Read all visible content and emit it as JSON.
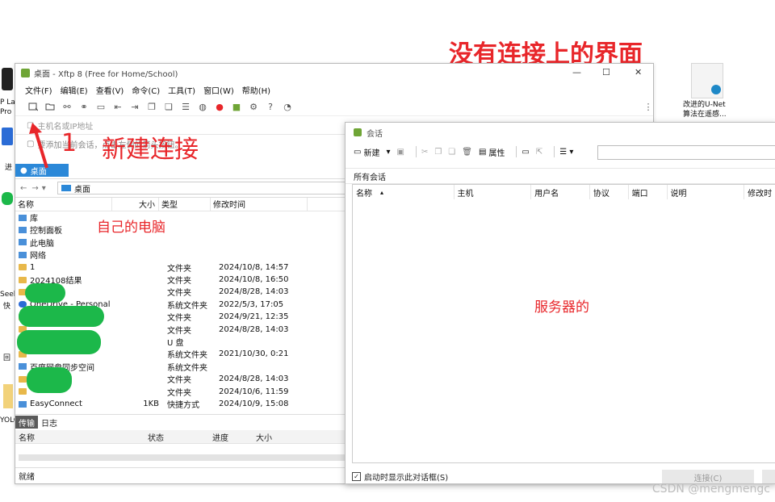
{
  "annotations": {
    "title": "没有连接上的界面",
    "step_number": "1",
    "new_connection": "新建连接",
    "my_computer": "自己的电脑",
    "server": "服务器的"
  },
  "colors": {
    "annotation_red": "#e8262a",
    "accent_blue": "#2b88d8",
    "blot_green": "#1cb84a"
  },
  "desktop": {
    "left_labels": [
      "P La",
      "Pro N",
      "进",
      "Seek",
      "快",
      "回",
      "YOLO"
    ],
    "icon_label_line1": "改进的U-Net",
    "icon_label_line2": "算法在遥感..."
  },
  "window": {
    "title": "桌面 - Xftp 8 (Free for Home/School)",
    "controls": {
      "minimize": "—",
      "maximize": "☐",
      "close": "✕"
    },
    "menu": [
      "文件(F)",
      "编辑(E)",
      "查看(V)",
      "命令(C)",
      "工具(T)",
      "窗口(W)",
      "帮助(H)"
    ],
    "host_placeholder": "主机名或IP地址",
    "tip_text": "要添加当前会话，点击左侧的箭头按钮。",
    "tab_label": "桌面",
    "path": "桌面",
    "columns": {
      "name": "名称",
      "size": "大小",
      "type": "类型",
      "modified": "修改时间"
    },
    "files": [
      {
        "name": "库",
        "size": "",
        "type": "",
        "modified": "",
        "icon": "library-icon"
      },
      {
        "name": "控制面板",
        "size": "",
        "type": "",
        "modified": "",
        "icon": "control-panel-icon"
      },
      {
        "name": "此电脑",
        "size": "",
        "type": "",
        "modified": "",
        "icon": "computer-icon"
      },
      {
        "name": "网络",
        "size": "",
        "type": "",
        "modified": "",
        "icon": "network-icon"
      },
      {
        "name": "1",
        "size": "",
        "type": "文件夹",
        "modified": "2024/10/8, 14:57",
        "icon": "folder-icon"
      },
      {
        "name": "2024108结果",
        "size": "",
        "type": "文件夹",
        "modified": "2024/10/8, 16:50",
        "icon": "folder-icon"
      },
      {
        "name": "",
        "size": "",
        "type": "文件夹",
        "modified": "2024/8/28, 14:03",
        "icon": "folder-icon"
      },
      {
        "name": "OneDrive - Personal",
        "size": "",
        "type": "系统文件夹",
        "modified": "2022/5/3, 17:05",
        "icon": "cloud-icon"
      },
      {
        "name": "",
        "size": "",
        "type": "文件夹",
        "modified": "2024/9/21, 12:35",
        "icon": "folder-icon"
      },
      {
        "name": "",
        "size": "",
        "type": "文件夹",
        "modified": "2024/8/28, 14:03",
        "icon": "folder-icon"
      },
      {
        "name": "",
        "size": "",
        "type": "U 盘",
        "modified": "",
        "icon": "usb-icon"
      },
      {
        "name": "",
        "size": "",
        "type": "系统文件夹",
        "modified": "2021/10/30, 0:21",
        "icon": "folder-icon"
      },
      {
        "name": "百度网盘同步空间",
        "size": "",
        "type": "系统文件夹",
        "modified": "",
        "icon": "baidu-icon"
      },
      {
        "name": "",
        "size": "",
        "type": "文件夹",
        "modified": "2024/8/28, 14:03",
        "icon": "folder-icon"
      },
      {
        "name": "",
        "size": "",
        "type": "文件夹",
        "modified": "2024/10/6, 11:59",
        "icon": "folder-icon"
      },
      {
        "name": "EasyConnect",
        "size": "1KB",
        "type": "快捷方式",
        "modified": "2024/10/9, 15:08",
        "icon": "shortcut-icon"
      }
    ],
    "bottom_tabs": [
      "传输",
      "日志"
    ],
    "transfer_columns": [
      "名称",
      "状态",
      "进度",
      "大小"
    ],
    "status": "就绪"
  },
  "session_dialog": {
    "title": "会话",
    "toolbar": {
      "new": "新建",
      "properties": "属性"
    },
    "all_sessions": "所有会话",
    "columns": [
      "名称",
      "主机",
      "用户名",
      "协议",
      "端口",
      "说明",
      "修改时"
    ],
    "startup_checkbox": "启动时显示此对话框(S)",
    "connect_button": "连接(C)"
  },
  "watermark": "CSDN @mengmengc"
}
